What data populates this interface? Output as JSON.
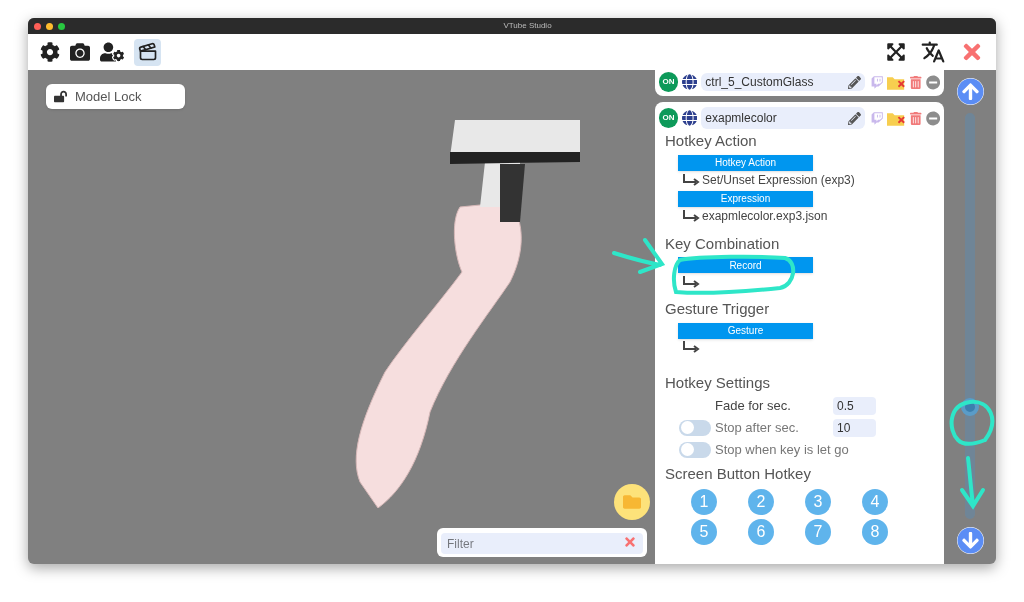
{
  "window": {
    "title": "VTube Studio"
  },
  "model_lock": {
    "label": "Model Lock",
    "locked": false
  },
  "filter": {
    "placeholder": "Filter"
  },
  "hotkeys": [
    {
      "name": "ctrl_5_CustomGlass",
      "badge": "ON",
      "on": true
    },
    {
      "name": "exapmlecolor",
      "badge": "ON",
      "on": true
    }
  ],
  "actions": [
    {
      "button": "Hotkey Action",
      "value": "Set/Unset Expression (exp3)",
      "title": "Hotkey Action"
    },
    {
      "button": "Expression",
      "value": "exapmlecolor.exp3.json"
    },
    {
      "button": "Record",
      "title": "Key Combination"
    },
    {
      "button": "Gesture",
      "title": "Gesture Trigger"
    }
  ],
  "settings": {
    "title": "Hotkey Settings",
    "rows": [
      {
        "kind": "number",
        "label": "Fade for sec.",
        "value": "0.5"
      },
      {
        "kind": "toggle-number",
        "label": "Stop after sec.",
        "on": false,
        "value": "10"
      },
      {
        "kind": "toggle",
        "label": "Stop when key is let go",
        "on": false
      }
    ]
  },
  "screen_buttons": {
    "title": "Screen Button Hotkey",
    "buttons": [
      {
        "label": "1",
        "selected": false
      },
      {
        "label": "2",
        "selected": false
      },
      {
        "label": "3",
        "selected": false
      },
      {
        "label": "4",
        "selected": false
      },
      {
        "label": "5",
        "selected": false
      },
      {
        "label": "6",
        "selected": false
      },
      {
        "label": "7",
        "selected": false
      },
      {
        "label": "8",
        "selected": false
      }
    ]
  }
}
